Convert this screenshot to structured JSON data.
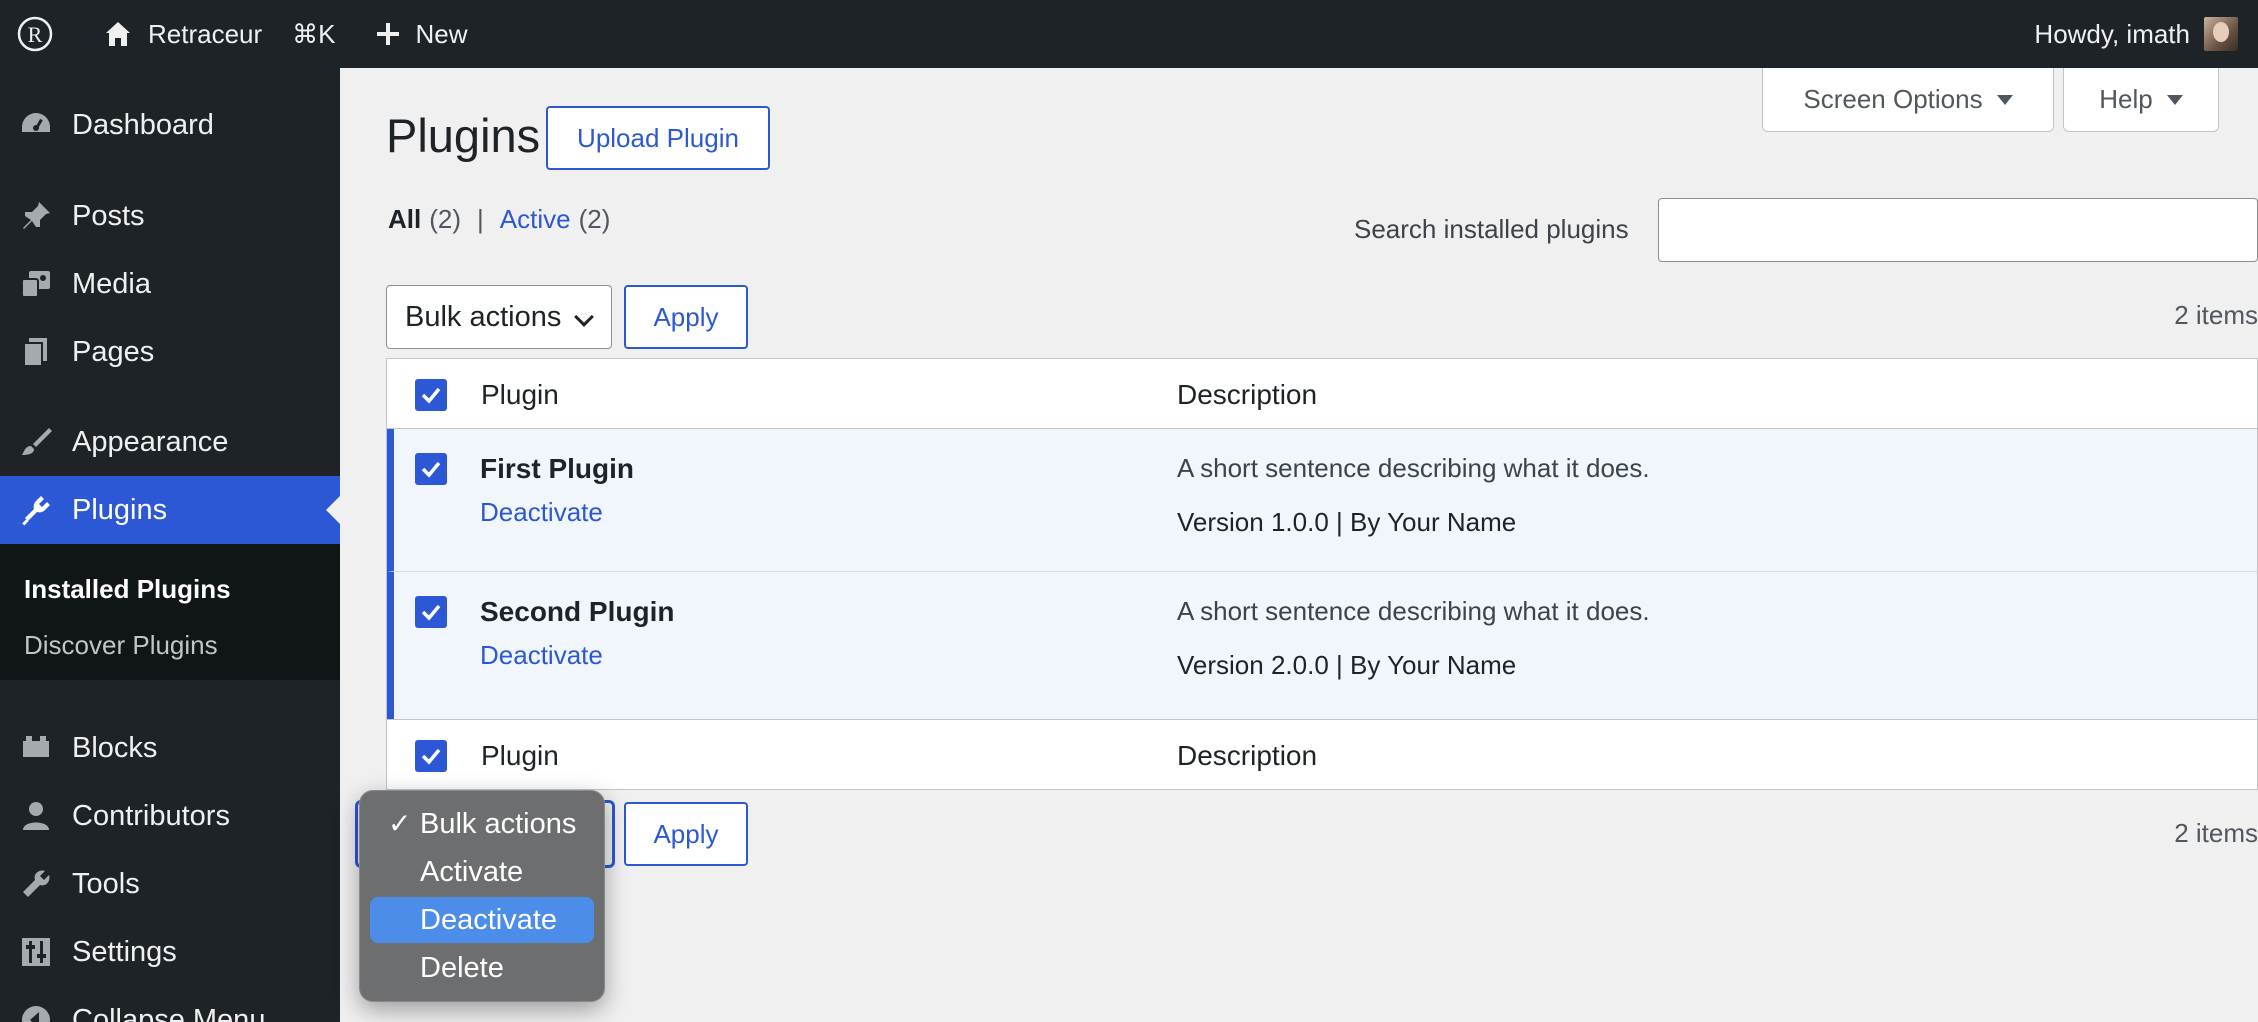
{
  "adminbar": {
    "site_name": "Retraceur",
    "shortcut": "⌘K",
    "new_label": "New",
    "howdy": "Howdy, imath"
  },
  "sidebar": {
    "items": [
      {
        "label": "Dashboard",
        "icon": "dashboard-icon"
      },
      {
        "label": "Posts",
        "icon": "pin-icon"
      },
      {
        "label": "Media",
        "icon": "media-icon"
      },
      {
        "label": "Pages",
        "icon": "pages-icon"
      },
      {
        "label": "Appearance",
        "icon": "paintbrush-icon"
      },
      {
        "label": "Plugins",
        "icon": "plugin-icon"
      },
      {
        "label": "Blocks",
        "icon": "blocks-icon"
      },
      {
        "label": "Contributors",
        "icon": "user-icon"
      },
      {
        "label": "Tools",
        "icon": "wrench-icon"
      },
      {
        "label": "Settings",
        "icon": "settings-icon"
      },
      {
        "label": "Collapse Menu",
        "icon": "collapse-icon"
      }
    ],
    "submenu": [
      "Installed Plugins",
      "Discover Plugins"
    ]
  },
  "screen_options": {
    "label": "Screen Options",
    "help": "Help"
  },
  "page": {
    "title": "Plugins",
    "upload_button": "Upload Plugin"
  },
  "filters": {
    "all_label": "All",
    "all_count": "(2)",
    "separator": "|",
    "active_label": "Active",
    "active_count": "(2)"
  },
  "search": {
    "label": "Search installed plugins",
    "value": ""
  },
  "bulk": {
    "selected": "Bulk actions",
    "apply": "Apply",
    "items_count": "2 items",
    "options": [
      "Bulk actions",
      "Activate",
      "Deactivate",
      "Delete"
    ],
    "highlighted": "Deactivate"
  },
  "table": {
    "columns": [
      "Plugin",
      "Description"
    ],
    "rows": [
      {
        "name": "First Plugin",
        "action": "Deactivate",
        "description": "A short sentence describing what it does.",
        "meta": "Version 1.0.0 | By Your Name"
      },
      {
        "name": "Second Plugin",
        "action": "Deactivate",
        "description": "A short sentence describing what it does.",
        "meta": "Version 2.0.0 | By Your Name"
      }
    ]
  },
  "colors": {
    "accent": "#2c58d5",
    "adminbar": "#1d2327",
    "background": "#f0f0f1",
    "dropdown_highlight": "#4c8de9"
  }
}
